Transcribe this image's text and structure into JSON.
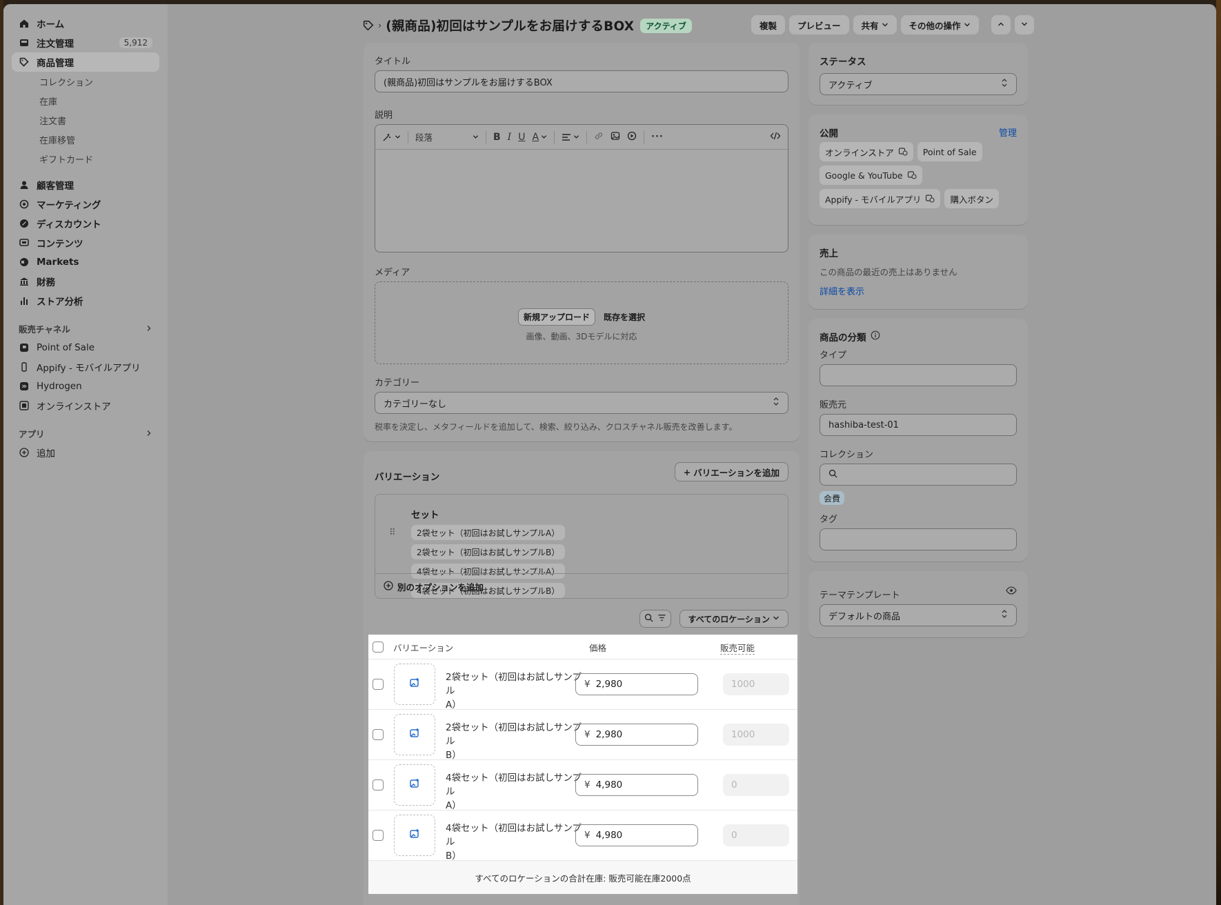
{
  "sidebar": {
    "items": [
      {
        "label": "ホーム",
        "icon": "home-icon"
      },
      {
        "label": "注文管理",
        "icon": "inbox-icon",
        "badge": "5,912"
      },
      {
        "label": "商品管理",
        "icon": "tag-icon",
        "active": true
      }
    ],
    "product_sub": [
      "コレクション",
      "在庫",
      "注文書",
      "在庫移管",
      "ギフトカード"
    ],
    "items2": [
      {
        "label": "顧客管理",
        "icon": "person-icon"
      },
      {
        "label": "マーケティング",
        "icon": "target-icon"
      },
      {
        "label": "ディスカウント",
        "icon": "discount-icon"
      },
      {
        "label": "コンテンツ",
        "icon": "content-icon"
      },
      {
        "label": "Markets",
        "icon": "globe-icon"
      },
      {
        "label": "財務",
        "icon": "bank-icon"
      },
      {
        "label": "ストア分析",
        "icon": "bar-chart-icon"
      }
    ],
    "channels_label": "販売チャネル",
    "channels": [
      {
        "label": "Point of Sale",
        "icon": "pos-icon"
      },
      {
        "label": "Appify - モバイルアプリ",
        "icon": "mobile-icon"
      },
      {
        "label": "Hydrogen",
        "icon": "hydrogen-icon"
      },
      {
        "label": "オンラインストア",
        "icon": "store-icon"
      }
    ],
    "apps_label": "アプリ",
    "add_label": "追加"
  },
  "header": {
    "title": "(親商品)初回はサンプルをお届けするBOX",
    "status_badge": "アクティブ",
    "actions": {
      "duplicate": "複製",
      "preview": "プレビュー",
      "share": "共有",
      "more": "その他の操作"
    }
  },
  "product": {
    "title_label": "タイトル",
    "title_value": "(親商品)初回はサンプルをお届けするBOX",
    "description_label": "説明",
    "paragraph_select": "段落",
    "media_label": "メディア",
    "upload_button": "新規アップロード",
    "select_existing": "既存を選択",
    "media_hint": "画像、動画、3Dモデルに対応",
    "category_label": "カテゴリー",
    "category_value": "カテゴリーなし",
    "category_hint": "税率を決定し、メタフィールドを追加して、検索、絞り込み、クロスチャネル販売を改善します。"
  },
  "variants": {
    "title": "バリエーション",
    "add_variant": "バリエーションを追加",
    "option_name": "セット",
    "option_values": [
      "2袋セット（初回はお試しサンプルA）",
      "2袋セット（初回はお試しサンプルB）",
      "4袋セット（初回はお試しサンプルA）",
      "4袋セット（初回はお試しサンプルB）"
    ],
    "add_option": "別のオプションを追加",
    "location_filter": "すべてのロケーション",
    "columns": {
      "variant": "バリエーション",
      "price": "価格",
      "available": "販売可能"
    },
    "currency": "¥",
    "rows": [
      {
        "name_line1": "2袋セット（初回はお試しサンプル",
        "name_line2": "A）",
        "price": "2,980",
        "available": "1000"
      },
      {
        "name_line1": "2袋セット（初回はお試しサンプル",
        "name_line2": "B）",
        "price": "2,980",
        "available": "1000"
      },
      {
        "name_line1": "4袋セット（初回はお試しサンプル",
        "name_line2": "A）",
        "price": "4,980",
        "available": "0"
      },
      {
        "name_line1": "4袋セット（初回はお試しサンプル",
        "name_line2": "B）",
        "price": "4,980",
        "available": "0"
      }
    ],
    "footer": "すべてのロケーションの合計在庫: 販売可能在庫2000点"
  },
  "status_card": {
    "title": "ステータス",
    "value": "アクティブ"
  },
  "publishing": {
    "title": "公開",
    "manage": "管理",
    "channels": [
      "オンラインストア",
      "Point of Sale",
      "Google & YouTube",
      "Appify - モバイルアプリ",
      "購入ボタン"
    ]
  },
  "sales": {
    "title": "売上",
    "empty": "この商品の最近の売上はありません",
    "details": "詳細を表示"
  },
  "organization": {
    "title": "商品の分類",
    "type_label": "タイプ",
    "type_value": "",
    "vendor_label": "販売元",
    "vendor_value": "hashiba-test-01",
    "collection_label": "コレクション",
    "collection_tag": "会費",
    "tags_label": "タグ"
  },
  "theme": {
    "title": "テーマテンプレート",
    "value": "デフォルトの商品"
  },
  "colors": {
    "active_badge_bg": "#b6d6c0",
    "link": "#0b4aa8",
    "overlay": "#9e9e9e"
  }
}
